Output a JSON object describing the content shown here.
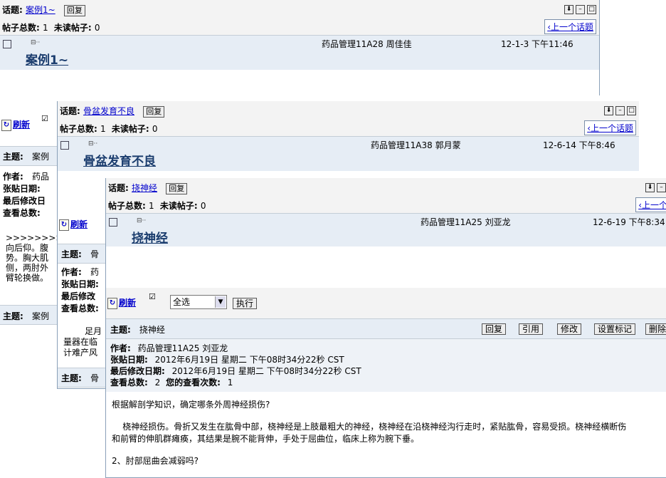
{
  "labels": {
    "topic": "话题:",
    "reply_small": "回复",
    "total_posts": "帖子总数:",
    "unread_posts": "未读帖子:",
    "prev_topic": "‹上一个话题",
    "refresh": "刷新",
    "subject": "主题:",
    "author": "作者:",
    "post_date": "张贴日期:",
    "last_modified": "最后修改日期:",
    "views": "查看总数:",
    "your_views": "您的查看次数:"
  },
  "win1": {
    "topic": "案例1~",
    "total": "1",
    "unread": "0",
    "post_title": "案例1~",
    "author": "药品管理11A28 周佳佳",
    "date": "12-1-3 下午11:46"
  },
  "win2": {
    "topic": "骨盆发育不良",
    "total": "1",
    "unread": "0",
    "post_title": "骨盆发育不良",
    "author": "药品管理11A38 郭月蒙",
    "date": "12-6-14 下午8:46",
    "subject_frag": "案例",
    "author_frag": "药品",
    "author2_frag": "药",
    "subject2_frag": "案例",
    "subject3_frag": "骨",
    "subject4_frag": "骨",
    "body_frag1": ">>>>>>>>",
    "body_frag2": "向后仰。腹",
    "body_frag3": "势。胸大肌",
    "body_frag4": "侧，两肘外",
    "body_frag5": "臂轮换做。",
    "body_frag6": "足月",
    "body_frag7": "量器在临",
    "body_frag8": "计难产风",
    "last_mod_frag": "最后修改日",
    "last_mod2_frag": "最后修改"
  },
  "win3": {
    "topic": "挠神经",
    "total": "1",
    "unread": "0",
    "post_title": "挠神经",
    "author": "药品管理11A25 刘亚龙",
    "date": "12-6-19 下午8:34",
    "select_value": "全选",
    "exec_label": "执行",
    "subject": "挠神经",
    "actions": [
      "回复",
      "引用",
      "修改",
      "设置标记",
      "删除"
    ],
    "meta_author": "药品管理11A25 刘亚龙",
    "meta_post_date": "2012年6月19日 星期二 下午08时34分22秒 CST",
    "meta_last_modified": "2012年6月19日 星期二 下午08时34分22秒 CST",
    "meta_views": "2",
    "meta_your_views": "1",
    "body1": "根据解剖学知识，确定哪条外周神经损伤?",
    "body2": "    桡神经损伤。骨折又发生在肱骨中部，桡神经是上肢最粗大的神经，桡神经在沿桡神经沟行走时，紧贴肱骨，容易受损。桡神经横断伤",
    "body3": "和前臂的伸肌群瘫痪，其结果是腕不能背伸，手处于屈曲位，临床上称为腕下垂。",
    "body4": "2、肘部屈曲会减弱吗?"
  }
}
